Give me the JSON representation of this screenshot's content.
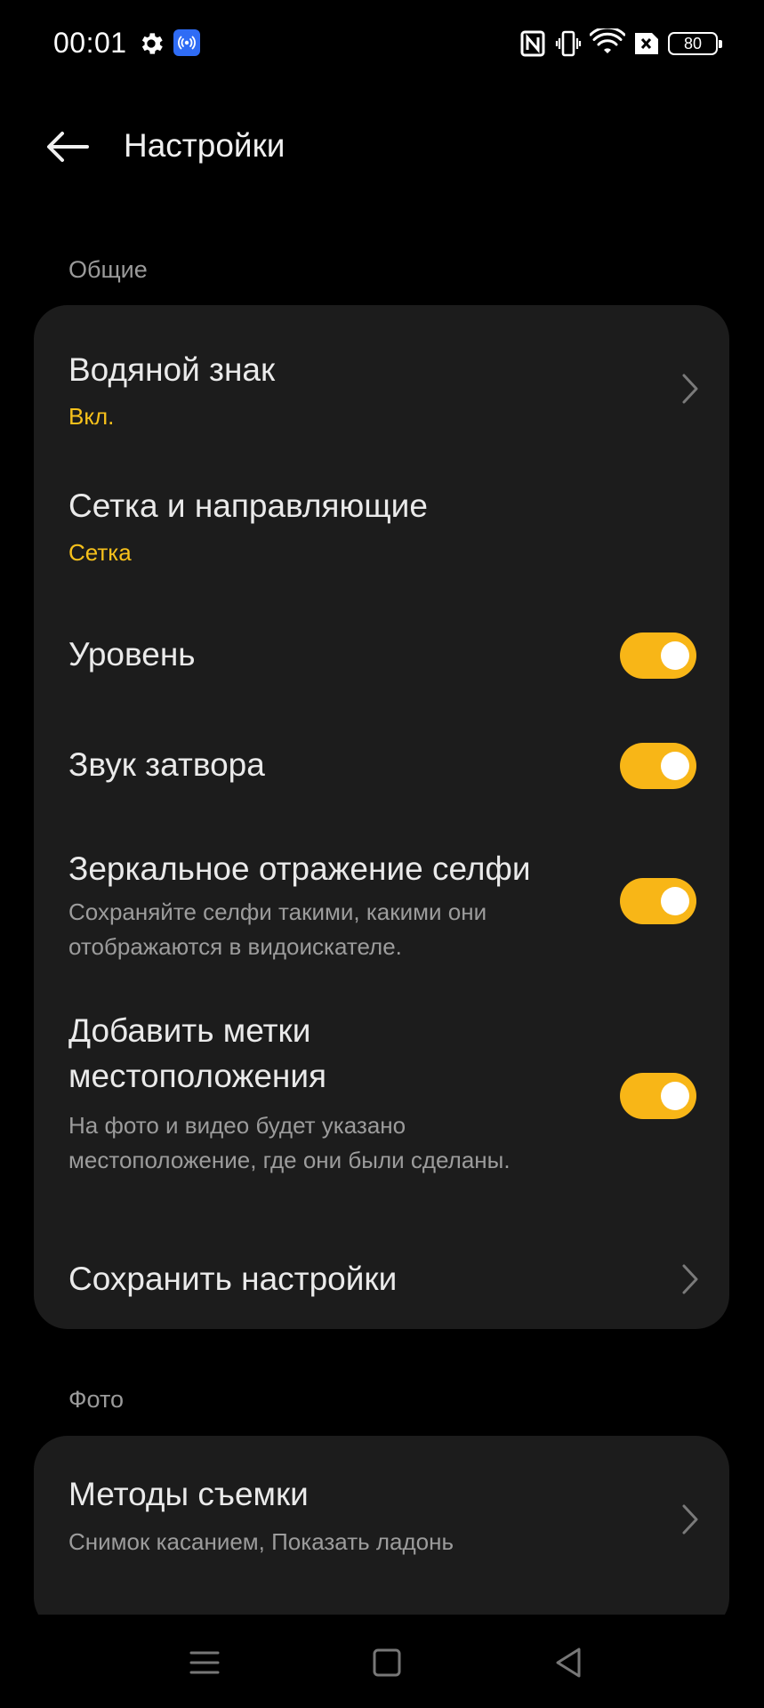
{
  "status_bar": {
    "time": "00:01",
    "battery": "80",
    "icons": [
      "gear-icon",
      "cast-icon",
      "nfc-icon",
      "vibrate-icon",
      "wifi-icon",
      "sim-off-icon",
      "battery-icon"
    ]
  },
  "header": {
    "title": "Настройки",
    "back_icon": "arrow-left-icon"
  },
  "sections": {
    "general": {
      "label": "Общие",
      "items": [
        {
          "title": "Водяной знак",
          "value": "Вкл.",
          "control": "chevron"
        },
        {
          "title": "Сетка и направляющие",
          "value": "Сетка",
          "control": "none"
        },
        {
          "title": "Уровень",
          "control": "toggle",
          "on": true
        },
        {
          "title": "Звук затвора",
          "control": "toggle",
          "on": true
        },
        {
          "title": "Зеркальное отражение селфи",
          "desc_line1": "Сохраняйте селфи такими, какими они",
          "desc_line2": "отображаются в видоискателе.",
          "control": "toggle",
          "on": true
        },
        {
          "title_line1": "Добавить метки",
          "title_line2": "местоположения",
          "desc_line1": "На фото и видео будет указано",
          "desc_line2": "местоположение, где они были сделаны.",
          "control": "toggle",
          "on": true
        },
        {
          "title": "Сохранить настройки",
          "control": "chevron"
        }
      ]
    },
    "photo": {
      "label": "Фото",
      "items": [
        {
          "title": "Методы съемки",
          "desc": "Снимок касанием, Показать ладонь",
          "control": "chevron"
        }
      ]
    }
  },
  "nav_bar": {
    "buttons": [
      "menu-icon",
      "home-icon",
      "back-triangle-icon"
    ]
  },
  "colors": {
    "accent": "#f8b617",
    "value_text": "#f7c11b",
    "card_bg": "#1c1c1c",
    "background": "#000000"
  }
}
